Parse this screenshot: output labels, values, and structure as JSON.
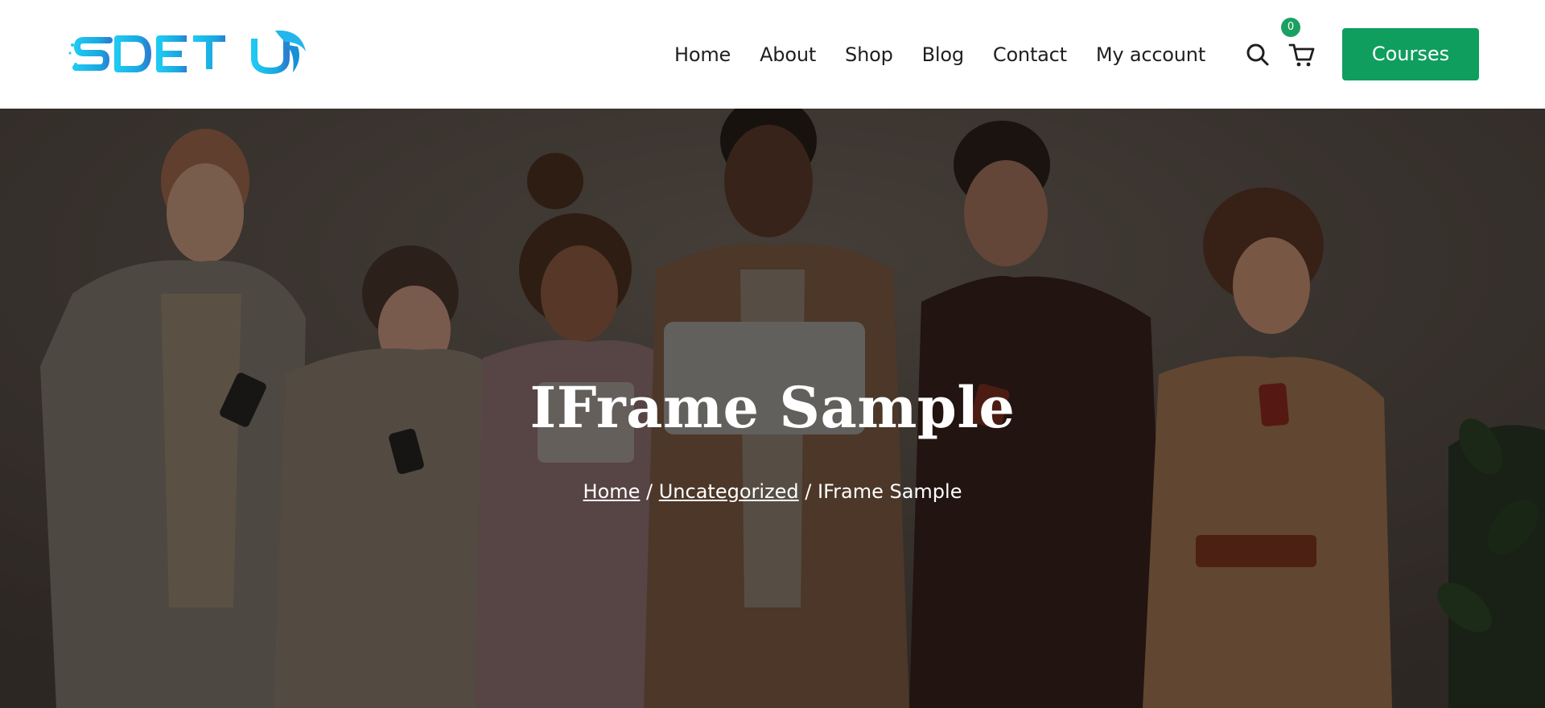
{
  "header": {
    "logo_text": "SDET-U",
    "nav": [
      {
        "label": "Home"
      },
      {
        "label": "About"
      },
      {
        "label": "Shop"
      },
      {
        "label": "Blog"
      },
      {
        "label": "Contact"
      },
      {
        "label": "My account"
      }
    ],
    "search_icon": "search-icon",
    "cart_icon": "cart-icon",
    "cart_count": "0",
    "courses_label": "Courses",
    "colors": {
      "accent": "#0f9e5e",
      "badge": "#1aa162",
      "logo": "#12b6e8"
    }
  },
  "hero": {
    "title": "IFrame Sample",
    "breadcrumb": {
      "home": "Home",
      "sep1": " / ",
      "category": "Uncategorized",
      "sep2": " / ",
      "current": "IFrame Sample"
    }
  }
}
